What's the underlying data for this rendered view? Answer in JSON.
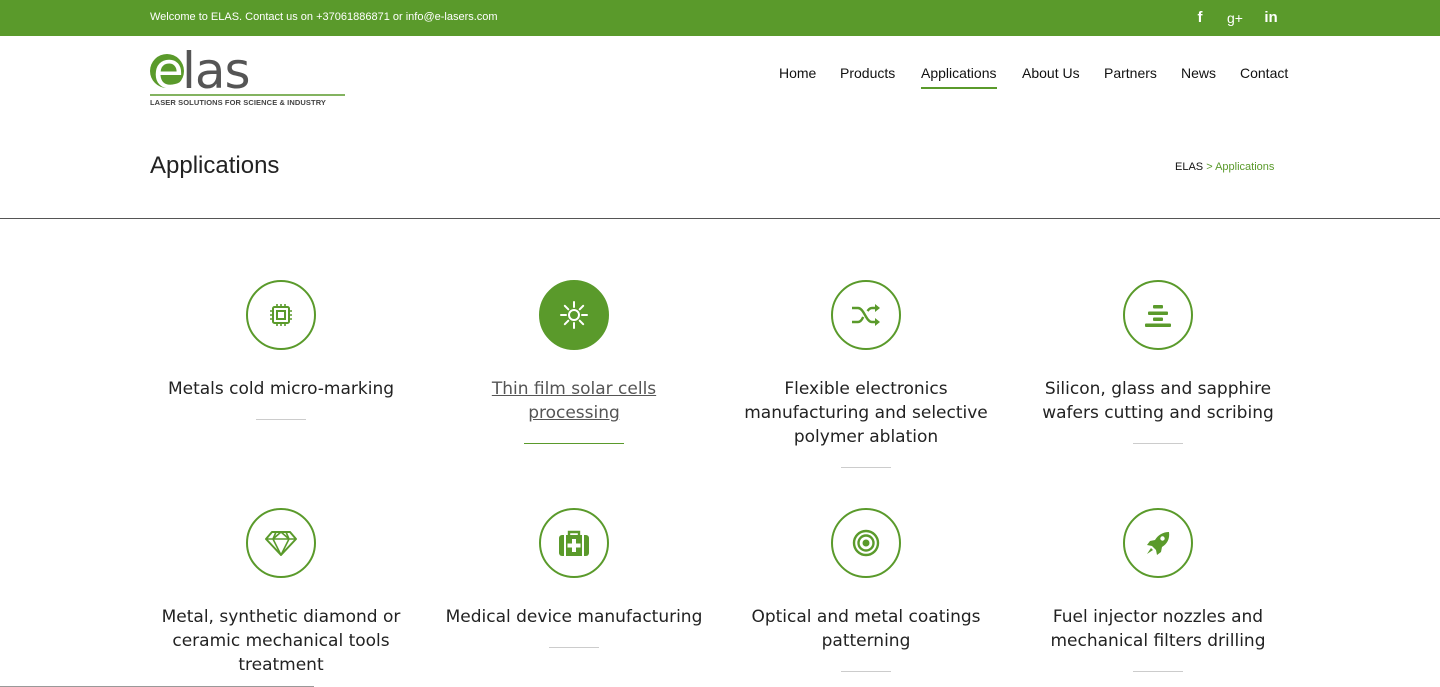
{
  "topbar": {
    "welcome_text": "Welcome to ELAS. Contact us on +37061886871 or info@e-lasers.com",
    "social": [
      {
        "icon": "facebook-icon",
        "glyph": "f"
      },
      {
        "icon": "google-plus-icon",
        "glyph": "g+"
      },
      {
        "icon": "linkedin-icon",
        "glyph": "in"
      }
    ]
  },
  "logo": {
    "wordmark": "elas",
    "tagline": "LASER SOLUTIONS FOR SCIENCE & INDUSTRY"
  },
  "nav": {
    "items": [
      {
        "label": "Home"
      },
      {
        "label": "Products"
      },
      {
        "label": "Applications",
        "active": true
      },
      {
        "label": "About Us"
      },
      {
        "label": "Partners"
      },
      {
        "label": "News"
      },
      {
        "label": "Contact"
      }
    ]
  },
  "page": {
    "title": "Applications",
    "breadcrumb": {
      "home": "ELAS",
      "separator": ">",
      "current": "Applications"
    }
  },
  "applications": [
    {
      "label": "Metals cold micro-marking",
      "icon": "chip-icon"
    },
    {
      "label": "Thin film solar cells processing",
      "icon": "sun-icon",
      "hovered": true
    },
    {
      "label": "Flexible electronics manufacturing and selective polymer ablation",
      "icon": "shuffle-icon"
    },
    {
      "label": "Silicon, glass and sapphire wafers cutting and scribing",
      "icon": "layers-icon"
    },
    {
      "label": "Metal, synthetic diamond or ceramic mechanical tools treatment",
      "icon": "diamond-icon"
    },
    {
      "label": "Medical device manufacturing",
      "icon": "medkit-icon"
    },
    {
      "label": "Optical and metal coatings patterning",
      "icon": "target-icon"
    },
    {
      "label": "Fuel injector nozzles and mechanical filters drilling",
      "icon": "rocket-icon"
    }
  ],
  "colors": {
    "accent": "#5a9a2b",
    "text": "#222222",
    "divider": "#cccccc"
  }
}
